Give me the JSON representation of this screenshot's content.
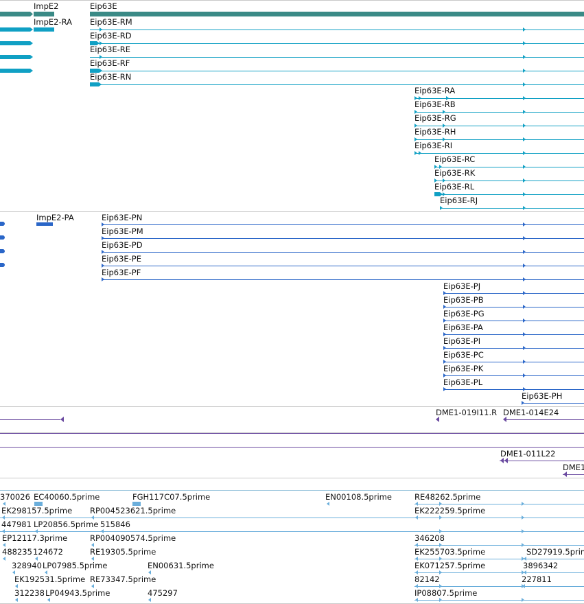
{
  "colors": {
    "gene": "#3a8a86",
    "transcript": "#10a0c4",
    "protein": "#2a66c8",
    "insertion": "#6a4aa0",
    "est": "#6aaedb"
  },
  "tracks": {
    "gene": {
      "name": "gene-track",
      "labels": [
        "ImpE2",
        "Eip63E"
      ]
    },
    "transcripts": {
      "name": "transcript-track",
      "rows": [
        {
          "label": "ImpE2-RA"
        },
        {
          "label": "Eip63E-RM"
        },
        {
          "label": "Eip63E-RD"
        },
        {
          "label": "Eip63E-RE"
        },
        {
          "label": "Eip63E-RF"
        },
        {
          "label": "Eip63E-RN"
        },
        {
          "label": "Eip63E-RA"
        },
        {
          "label": "Eip63E-RB"
        },
        {
          "label": "Eip63E-RG"
        },
        {
          "label": "Eip63E-RH"
        },
        {
          "label": "Eip63E-RI"
        },
        {
          "label": "Eip63E-RC"
        },
        {
          "label": "Eip63E-RK"
        },
        {
          "label": "Eip63E-RL"
        },
        {
          "label": "Eip63E-RJ"
        }
      ]
    },
    "proteins": {
      "name": "protein-track",
      "rows": [
        {
          "label": "ImpE2-PA"
        },
        {
          "label": "Eip63E-PN"
        },
        {
          "label": "Eip63E-PM"
        },
        {
          "label": "Eip63E-PD"
        },
        {
          "label": "Eip63E-PE"
        },
        {
          "label": "Eip63E-PF"
        },
        {
          "label": "Eip63E-PJ"
        },
        {
          "label": "Eip63E-PB"
        },
        {
          "label": "Eip63E-PG"
        },
        {
          "label": "Eip63E-PA"
        },
        {
          "label": "Eip63E-PI"
        },
        {
          "label": "Eip63E-PC"
        },
        {
          "label": "Eip63E-PK"
        },
        {
          "label": "Eip63E-PL"
        },
        {
          "label": "Eip63E-PH"
        }
      ]
    },
    "insertions": {
      "name": "insertion-track",
      "rows": [
        {
          "label": "DME1-019I11.R"
        },
        {
          "label": "DME1-014E24"
        },
        {
          "label": "DME1-011L22"
        },
        {
          "label": "DME1"
        }
      ]
    },
    "ests": {
      "name": "est-track",
      "rows": [
        {
          "label": "370026"
        },
        {
          "label": "EC40060.5prime"
        },
        {
          "label": "FGH117C07.5prime"
        },
        {
          "label": "EN00108.5prime"
        },
        {
          "label": "RE48262.5prime"
        },
        {
          "label": "EK298157.5prime"
        },
        {
          "label": "RP004523621.5prime"
        },
        {
          "label": "EK222259.5prime"
        },
        {
          "label": "447981"
        },
        {
          "label": "LP20856.5prime"
        },
        {
          "label": "515846"
        },
        {
          "label": "EP12117.3prime"
        },
        {
          "label": "RP004090574.5prime"
        },
        {
          "label": "346208"
        },
        {
          "label": "488235"
        },
        {
          "label": "124672"
        },
        {
          "label": "RE19305.5prime"
        },
        {
          "label": "EK255703.5prime"
        },
        {
          "label": "SD27919.5prime"
        },
        {
          "label": "328940"
        },
        {
          "label": "LP07985.5prime"
        },
        {
          "label": "EN00631.5prime"
        },
        {
          "label": "EK071257.5prime"
        },
        {
          "label": "3896342"
        },
        {
          "label": "EK192531.5prime"
        },
        {
          "label": "RE73347.5prime"
        },
        {
          "label": "82142"
        },
        {
          "label": "227811"
        },
        {
          "label": "312238"
        },
        {
          "label": "LP04943.5prime"
        },
        {
          "label": "475297"
        },
        {
          "label": "IP08807.5prime"
        }
      ]
    }
  }
}
